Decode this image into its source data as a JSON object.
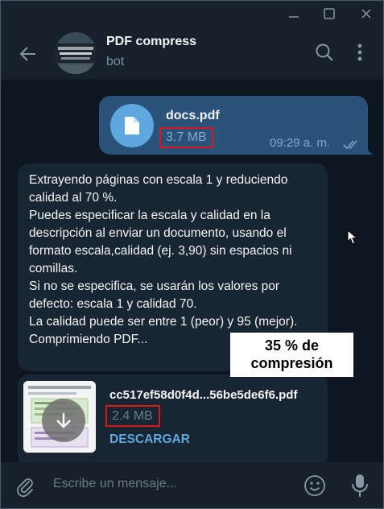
{
  "window": {
    "controls": [
      "minimize-icon",
      "maximize-icon",
      "close-icon"
    ]
  },
  "header": {
    "name": "PDF compress",
    "subtitle": "bot"
  },
  "messages": {
    "outgoing": {
      "file_name": "docs.pdf",
      "file_size": "3.7 MB",
      "time": "09:29 a. m.",
      "status": "read"
    },
    "incoming": {
      "text": "Extrayendo páginas con escala 1 y reduciendo calidad al 70 %.\nPuedes especificar la escala y calidad en la descripción al enviar un documento, usando el formato escala,calidad (ej. 3,90) sin espacios ni comillas.\nSi no se especifica, se usarán los valores por defecto: escala 1 y calidad 70.\nLa calidad puede ser entre 1 (peor) y 95 (mejor).\nComprimiendo PDF..."
    },
    "result_file": {
      "file_name": "cc517ef58d0f4d...56be5de6f6.pdf",
      "file_size": "2.4 MB",
      "action": "DESCARGAR"
    }
  },
  "annotation": {
    "line1": "35 % de",
    "line2": "compresión"
  },
  "composer": {
    "placeholder": "Escribe un mensaje..."
  },
  "colors": {
    "outgoing_bubble": "#2b5278",
    "incoming_bubble": "#182533",
    "accent": "#5ea8e0",
    "highlight_box": "#d61a1a"
  }
}
